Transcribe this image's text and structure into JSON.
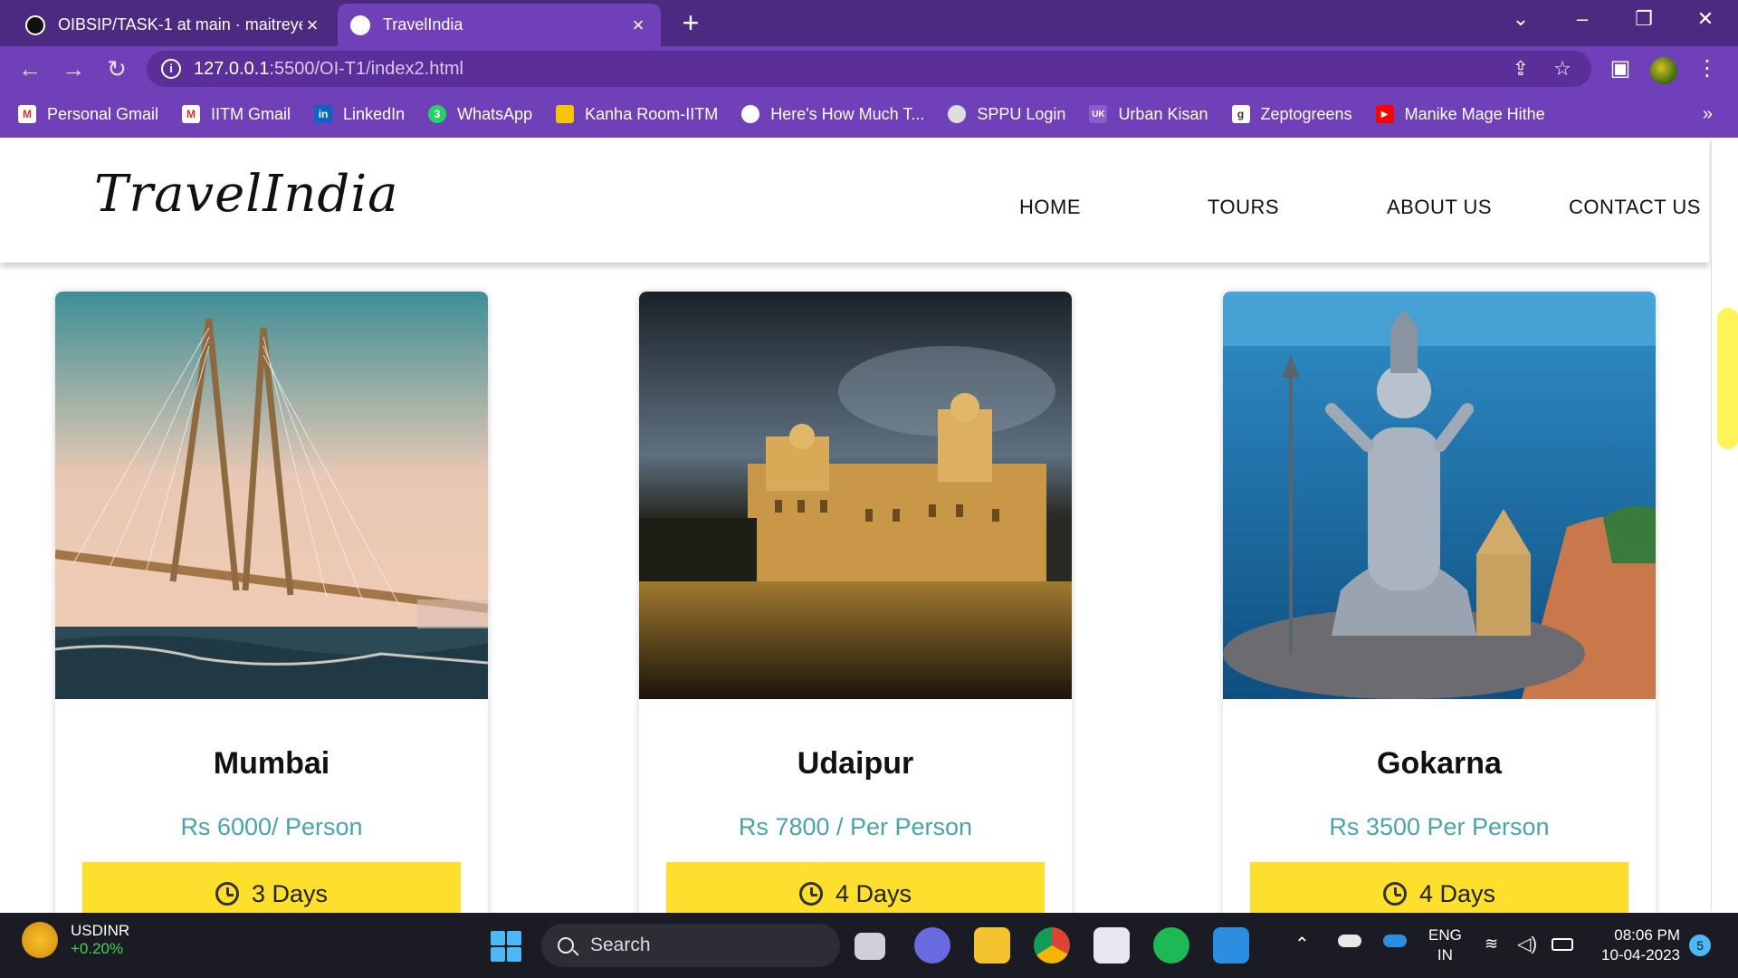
{
  "browser": {
    "tabs": [
      {
        "title": "OIBSIP/TASK-1 at main · maitreye",
        "active": false
      },
      {
        "title": "TravelIndia",
        "active": true
      }
    ],
    "new_tab": "+",
    "url_host": "127.0.0.1",
    "url_rest": ":5500/OI-T1/index2.html",
    "bookmarks": [
      {
        "label": "Personal Gmail",
        "icon": "gmail-icon"
      },
      {
        "label": "IITM Gmail",
        "icon": "gmail-icon"
      },
      {
        "label": "LinkedIn",
        "icon": "linkedin-icon"
      },
      {
        "label": "WhatsApp",
        "icon": "whatsapp-icon"
      },
      {
        "label": "Kanha Room-IITM",
        "icon": "sheets-icon"
      },
      {
        "label": "Here's How Much T...",
        "icon": "globe-icon"
      },
      {
        "label": "SPPU Login",
        "icon": "sppu-icon"
      },
      {
        "label": "Urban Kisan",
        "icon": "urban-kisan-icon"
      },
      {
        "label": "Zeptogreens",
        "icon": "zepto-icon"
      },
      {
        "label": "Manike Mage Hithe",
        "icon": "youtube-icon"
      }
    ],
    "bookmarks_more": "»"
  },
  "site": {
    "logo": "TravelIndia",
    "nav": [
      "HOME",
      "TOURS",
      "ABOUT US",
      "CONTACT US"
    ],
    "cards": [
      {
        "city": "Mumbai",
        "price": "Rs 6000/ Person",
        "days": "3 Days"
      },
      {
        "city": "Udaipur",
        "price": "Rs 7800 / Per Person",
        "days": "4 Days"
      },
      {
        "city": "Gokarna",
        "price": "Rs 3500 Per Person",
        "days": "4 Days"
      }
    ]
  },
  "taskbar": {
    "ticker_name": "USDINR",
    "ticker_change": "+0.20%",
    "search_label": "Search",
    "lang_line1": "ENG",
    "lang_line2": "IN",
    "time": "08:06 PM",
    "date": "10-04-2023",
    "notifications": "5"
  },
  "colors": {
    "tab_strip": "#4d2a82",
    "toolbar": "#7040b8",
    "price_teal": "#4aa3a8",
    "days_yellow": "#fddf2c",
    "scroll_thumb": "#fff35a"
  }
}
